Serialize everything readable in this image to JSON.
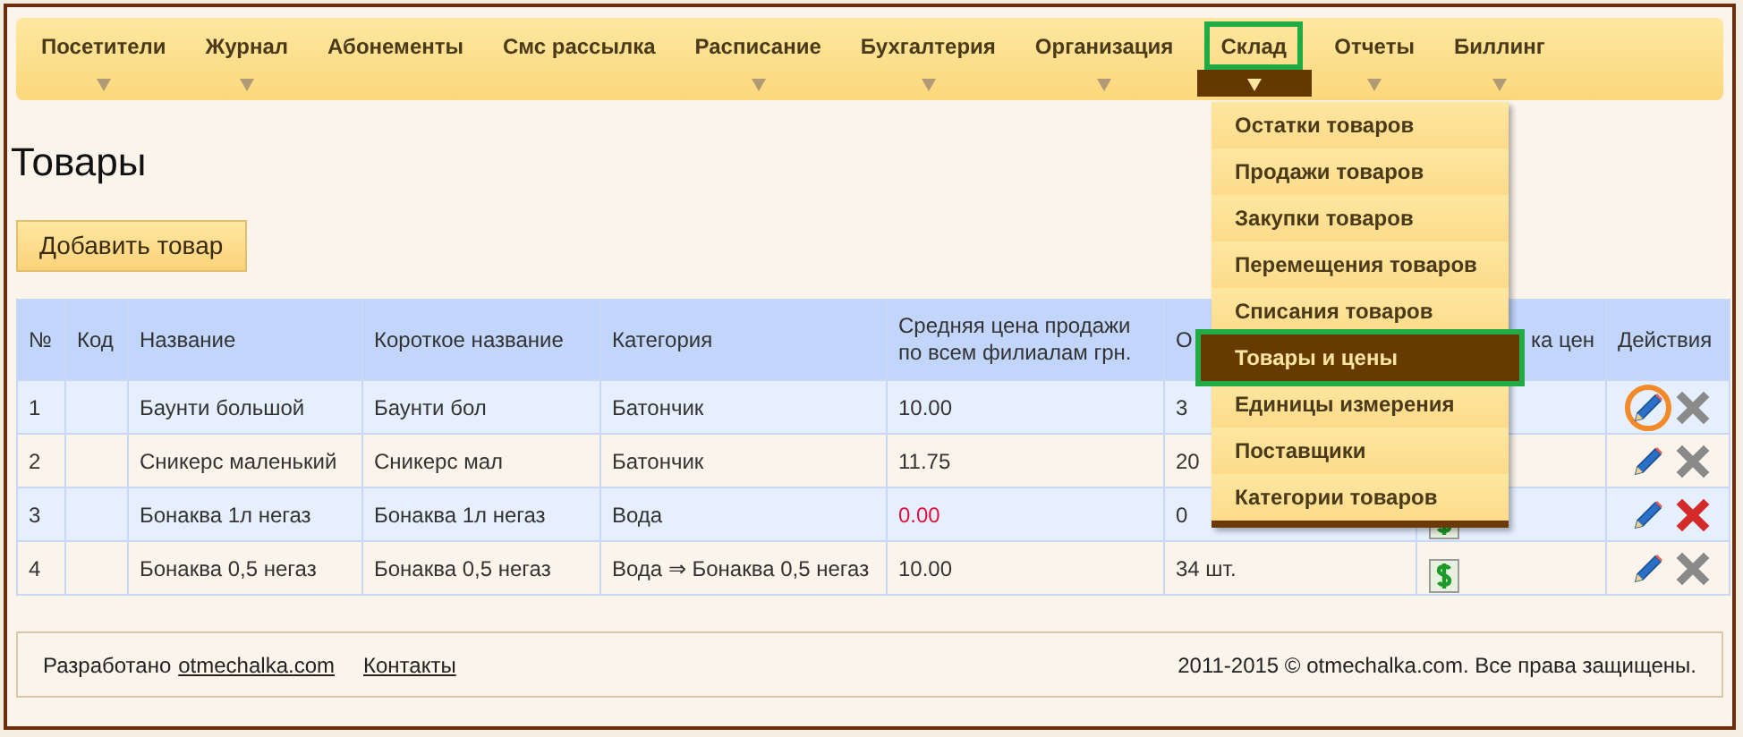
{
  "nav": {
    "items": [
      {
        "label": "Посетители",
        "has_arrow": true,
        "selected": false,
        "highlighted": false
      },
      {
        "label": "Журнал",
        "has_arrow": true,
        "selected": false,
        "highlighted": false
      },
      {
        "label": "Абонементы",
        "has_arrow": false,
        "selected": false,
        "highlighted": false
      },
      {
        "label": "Смс рассылка",
        "has_arrow": false,
        "selected": false,
        "highlighted": false
      },
      {
        "label": "Расписание",
        "has_arrow": true,
        "selected": false,
        "highlighted": false
      },
      {
        "label": "Бухгалтерия",
        "has_arrow": true,
        "selected": false,
        "highlighted": false
      },
      {
        "label": "Организация",
        "has_arrow": true,
        "selected": false,
        "highlighted": false
      },
      {
        "label": "Склад",
        "has_arrow": true,
        "selected": true,
        "highlighted": true
      },
      {
        "label": "Отчеты",
        "has_arrow": true,
        "selected": false,
        "highlighted": false
      },
      {
        "label": "Биллинг",
        "has_arrow": true,
        "selected": false,
        "highlighted": false
      }
    ]
  },
  "dropdown": {
    "items": [
      {
        "label": "Остатки товаров",
        "selected": false,
        "highlighted": false
      },
      {
        "label": "Продажи товаров",
        "selected": false,
        "highlighted": false
      },
      {
        "label": "Закупки товаров",
        "selected": false,
        "highlighted": false
      },
      {
        "label": "Перемещения товаров",
        "selected": false,
        "highlighted": false
      },
      {
        "label": "Списания товаров",
        "selected": false,
        "highlighted": false
      },
      {
        "label": "Товары и цены",
        "selected": true,
        "highlighted": true
      },
      {
        "label": "Единицы измерения",
        "selected": false,
        "highlighted": false
      },
      {
        "label": "Поставщики",
        "selected": false,
        "highlighted": false
      },
      {
        "label": "Категории товаров",
        "selected": false,
        "highlighted": false
      }
    ]
  },
  "page_title": "Товары",
  "add_button": "Добавить товар",
  "table": {
    "columns": [
      "№",
      "Код",
      "Название",
      "Короткое название",
      "Категория",
      "Средняя цена продажи по всем филиалам грн.",
      "О",
      "ка цен",
      "Действия"
    ],
    "rows": [
      {
        "num": "1",
        "code": "",
        "name": "Баунти большой",
        "short": "Баунти бол",
        "category": "Батончик",
        "price": "10.00",
        "price_warning": false,
        "stock": "3",
        "price_icon": false,
        "edit_highlighted": true,
        "delete_active": false
      },
      {
        "num": "2",
        "code": "",
        "name": "Сникерс маленький",
        "short": "Сникерс мал",
        "category": "Батончик",
        "price": "11.75",
        "price_warning": false,
        "stock": "20",
        "price_icon": false,
        "edit_highlighted": false,
        "delete_active": false
      },
      {
        "num": "3",
        "code": "",
        "name": "Бонаква 1л негаз",
        "short": "Бонаква 1л негаз",
        "category": "Вода",
        "price": "0.00",
        "price_warning": true,
        "stock": "0",
        "price_icon": true,
        "edit_highlighted": false,
        "delete_active": true
      },
      {
        "num": "4",
        "code": "",
        "name": "Бонаква 0,5 негаз",
        "short": "Бонаква 0,5 негаз",
        "category": "Вода ⇒ Бонаква 0,5 негаз",
        "price": "10.00",
        "price_warning": false,
        "stock": "34 шт.",
        "price_icon": true,
        "edit_highlighted": false,
        "delete_active": false
      }
    ]
  },
  "footer": {
    "developed": "Разработано",
    "developer_link": "otmechalka.com",
    "contacts_link": "Контакты",
    "copyright": "2011-2015 © otmechalka.com. Все права защищены."
  }
}
